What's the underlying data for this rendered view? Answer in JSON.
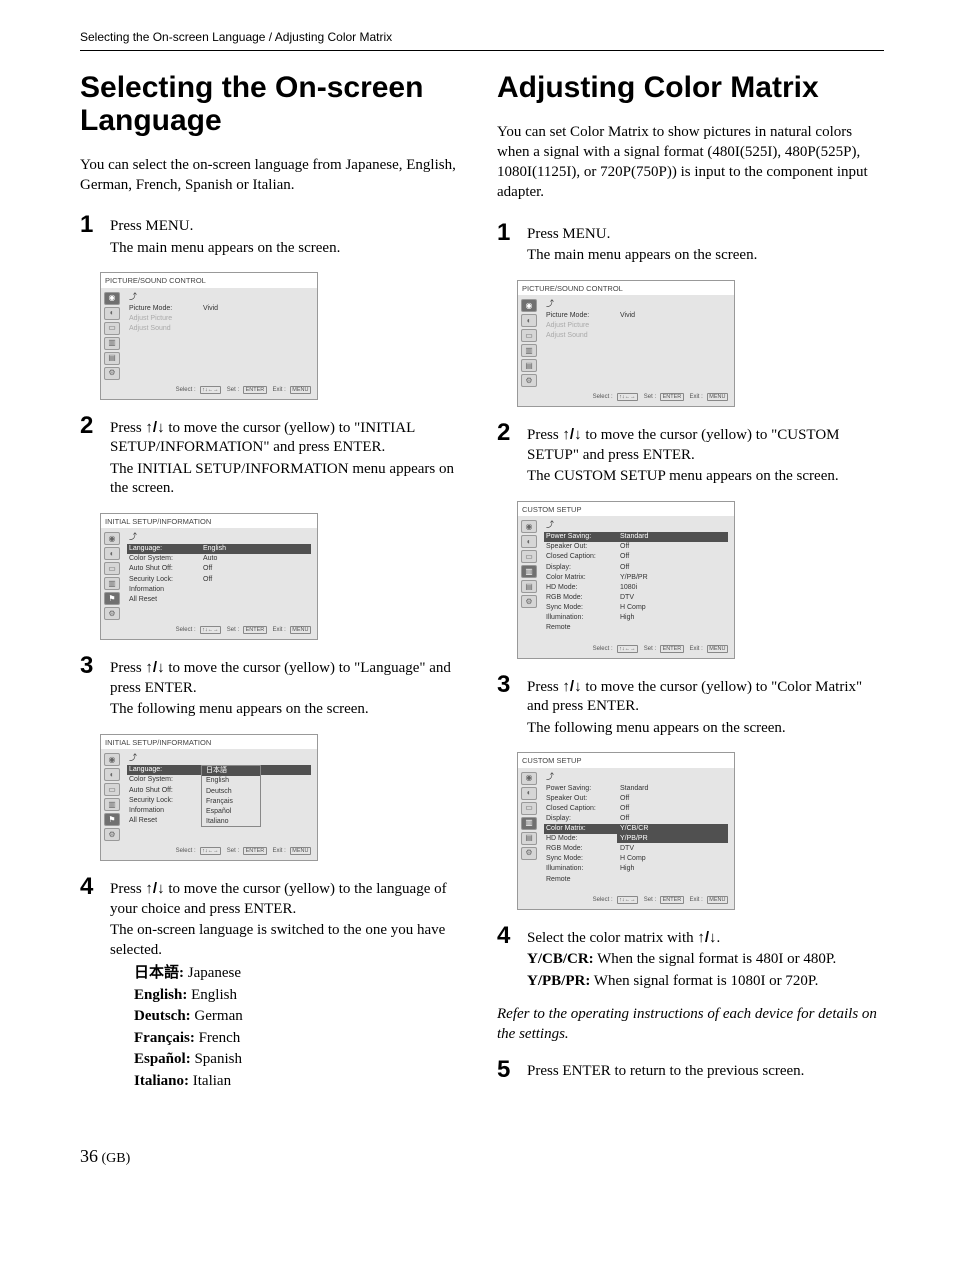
{
  "breadcrumb": "Selecting the On-screen Language / Adjusting Color Matrix",
  "left": {
    "heading": "Selecting the On-screen Language",
    "intro": "You can select the on-screen language from Japanese, English, German, French, Spanish or Italian.",
    "step1_a": "Press MENU.",
    "step1_b": "The main menu appears on the screen.",
    "step2_a": "Press ",
    "step2_b": " to move the cursor (yellow) to \"INITIAL SETUP/INFORMATION\" and press ENTER.",
    "step2_c": "The INITIAL SETUP/INFORMATION menu appears on the screen.",
    "step3_a": "Press ",
    "step3_b": " to move the cursor (yellow) to \"Language\" and press ENTER.",
    "step3_c": "The following menu appears on the screen.",
    "step4_a": "Press ",
    "step4_b": " to move the cursor (yellow) to the language of your choice and press ENTER.",
    "step4_c": "The on-screen language is switched to the one you have selected.",
    "langs": {
      "jp_l": "日本語:",
      "jp_v": " Japanese",
      "en_l": "English:",
      "en_v": " English",
      "de_l": "Deutsch:",
      "de_v": " German",
      "fr_l": "Français:",
      "fr_v": " French",
      "es_l": "Español:",
      "es_v": " Spanish",
      "it_l": "Italiano:",
      "it_v": " Italian"
    }
  },
  "right": {
    "heading": "Adjusting Color Matrix",
    "intro": "You can set Color Matrix to show pictures in natural colors when a signal with a signal format (480I(525I), 480P(525P), 1080I(1125I), or 720P(750P)) is input to the component input adapter.",
    "step1_a": "Press MENU.",
    "step1_b": "The main menu appears on the screen.",
    "step2_a": "Press ",
    "step2_b": " to move the cursor (yellow) to \"CUSTOM SETUP\" and press ENTER.",
    "step2_c": "The CUSTOM SETUP menu appears on the screen.",
    "step3_a": "Press ",
    "step3_b": " to move the cursor (yellow) to \"Color Matrix\" and press ENTER.",
    "step3_c": "The following menu appears on the screen.",
    "step4_a": "Select the color matrix with ",
    "step4_b": ".",
    "step4_c_l": "Y/CB/CR:",
    "step4_c_v": " When the signal format is 480I or 480P.",
    "step4_d_l": "Y/PB/PR:",
    "step4_d_v": " When signal format is 1080I or 720P.",
    "note": "Refer to the operating instructions of each device for details on the settings.",
    "step5_a": "Press ENTER to return to the previous screen."
  },
  "menus": {
    "pictureSound": {
      "title": "PICTURE/SOUND CONTROL",
      "rows": [
        {
          "lbl": "Picture Mode:",
          "val": "Vivid"
        },
        {
          "lbl": "Adjust Picture",
          "val": "",
          "dim": true
        },
        {
          "lbl": "Adjust Sound",
          "val": "",
          "dim": true
        }
      ]
    },
    "initialSetup": {
      "title": "INITIAL SETUP/INFORMATION",
      "rows": [
        {
          "lbl": "Language:",
          "val": "English",
          "hl": true
        },
        {
          "lbl": "Color System:",
          "val": "Auto"
        },
        {
          "lbl": "Auto Shut Off:",
          "val": "Off"
        },
        {
          "lbl": "Security Lock:",
          "val": "Off"
        },
        {
          "lbl": "Information",
          "val": ""
        },
        {
          "lbl": "All Reset",
          "val": ""
        }
      ]
    },
    "initialSetupLang": {
      "title": "INITIAL SETUP/INFORMATION",
      "rows": [
        {
          "lbl": "Language:",
          "val": "",
          "hl": true
        },
        {
          "lbl": "Color System:",
          "val": ""
        },
        {
          "lbl": "Auto Shut Off:",
          "val": ""
        },
        {
          "lbl": "Security Lock:",
          "val": ""
        },
        {
          "lbl": "Information",
          "val": ""
        },
        {
          "lbl": "All Reset",
          "val": ""
        }
      ],
      "dropdown": [
        "日本語",
        "English",
        "Deutsch",
        "Français",
        "Español",
        "Italiano"
      ]
    },
    "customSetup": {
      "title": "CUSTOM SETUP",
      "rows": [
        {
          "lbl": "Power Saving:",
          "val": "Standard",
          "hl": true
        },
        {
          "lbl": "Speaker Out:",
          "val": "Off"
        },
        {
          "lbl": "Closed Caption:",
          "val": "Off"
        },
        {
          "lbl": "Display:",
          "val": "Off"
        },
        {
          "lbl": "Color Matrix:",
          "val": "Y/PB/PR"
        },
        {
          "lbl": "HD Mode:",
          "val": "1080i"
        },
        {
          "lbl": "RGB Mode:",
          "val": "DTV"
        },
        {
          "lbl": "Sync Mode:",
          "val": "H Comp"
        },
        {
          "lbl": "Illumination:",
          "val": "High"
        },
        {
          "lbl": "Remote",
          "val": ""
        }
      ]
    },
    "customSetupCM": {
      "title": "CUSTOM SETUP",
      "rows": [
        {
          "lbl": "Power Saving:",
          "val": "Standard"
        },
        {
          "lbl": "Speaker Out:",
          "val": "Off"
        },
        {
          "lbl": "Closed Caption:",
          "val": "Off"
        },
        {
          "lbl": "Display:",
          "val": "Off"
        },
        {
          "lbl": "Color Matrix:",
          "val": "Y/CB/CR",
          "hl": true
        },
        {
          "lbl": "HD Mode:",
          "val": "Y/PB/PR"
        },
        {
          "lbl": "RGB Mode:",
          "val": "DTV",
          "dropcover": true
        },
        {
          "lbl": "Sync Mode:",
          "val": "H Comp"
        },
        {
          "lbl": "Illumination:",
          "val": "High"
        },
        {
          "lbl": "Remote",
          "val": ""
        }
      ]
    },
    "footer": {
      "select": "Select :",
      "arrows": "↑↓←→",
      "set": "Set :",
      "setkey": "ENTER",
      "exit": "Exit :",
      "exitkey": "MENU"
    }
  },
  "pageNo": "36",
  "pageSuffix": " (GB)"
}
